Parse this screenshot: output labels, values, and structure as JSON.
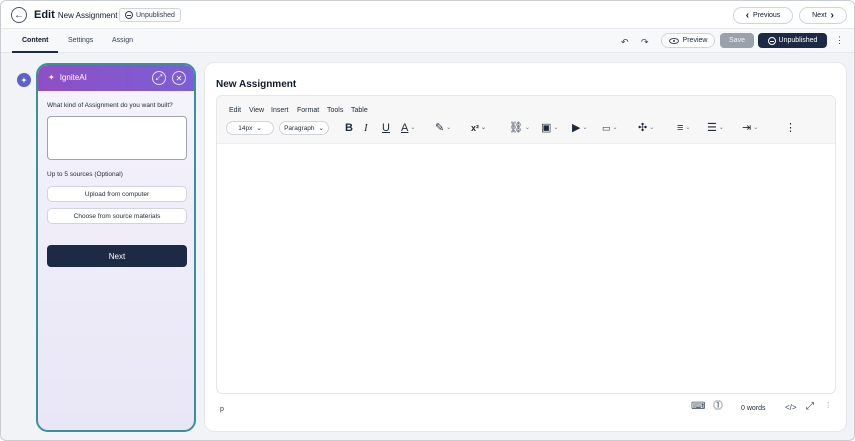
{
  "header": {
    "title_bold": "Edit",
    "title_rest": "New Assignment",
    "status_badge": "Unpublished",
    "prev_label": "Previous",
    "next_label": "Next"
  },
  "tabs": [
    {
      "label": "Content",
      "active": true
    },
    {
      "label": "Settings",
      "active": false
    },
    {
      "label": "Assign",
      "active": false
    }
  ],
  "actions": {
    "preview_label": "Preview",
    "save_label": "Save",
    "publish_state_label": "Unpublished"
  },
  "ai_panel": {
    "title": "IgniteAI",
    "question": "What kind of Assignment do you want built?",
    "prompt_value": "",
    "sources_label": "Up to 5 sources (Optional)",
    "upload_label": "Upload from computer",
    "choose_label": "Choose from source materials",
    "next_label": "Next"
  },
  "editor": {
    "assignment_title": "New Assignment",
    "menus": [
      "Edit",
      "View",
      "Insert",
      "Format",
      "Tools",
      "Table"
    ],
    "font_size": "14px",
    "block_format": "Paragraph",
    "path_indicator": "p",
    "word_count": "0 words",
    "source_code_label": "</>"
  },
  "colors": {
    "primary_dark": "#1e2a44",
    "ai_header_purple": "#8e4fc6",
    "ai_border_teal": "#3a8f98",
    "save_disabled": "#9aa1ab"
  },
  "icons": {
    "back": "arrow-left-icon",
    "ai_rail": "sparkle-icon",
    "undo": "undo-icon",
    "redo": "redo-icon",
    "preview": "eye-icon",
    "expand": "expand-icon",
    "close": "close-icon"
  }
}
